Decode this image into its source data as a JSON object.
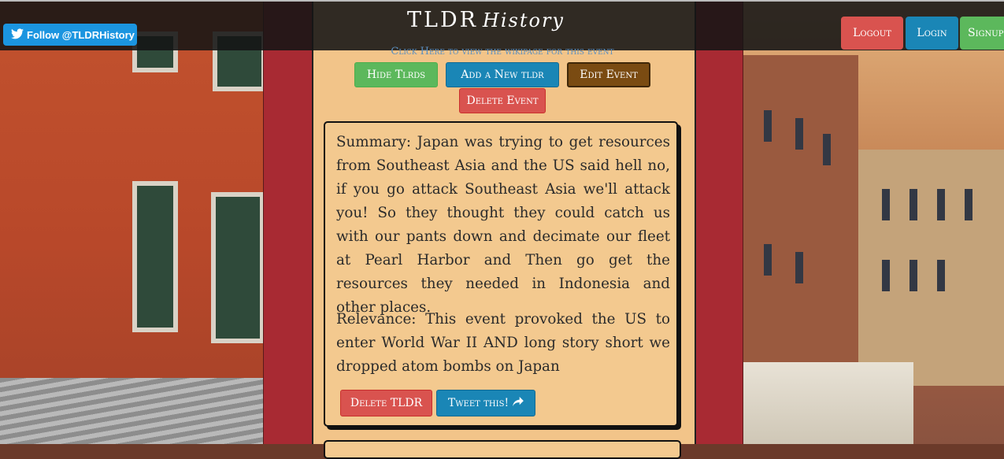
{
  "header": {
    "brand_main": "TLDR",
    "brand_script": "History",
    "follow_label": "Follow @TLDRHistory",
    "auth": {
      "logout": "Logout",
      "login": "Login",
      "signup": "Signup"
    }
  },
  "event": {
    "wiki_link": "Click Here to view the wikipage for this event",
    "actions": {
      "hide_tldrs": "Hide Tlrds",
      "add_tldr": "Add a New tldr",
      "edit_event": "Edit Event",
      "delete_event": "Delete Event"
    }
  },
  "tldr": {
    "summary": "Summary: Japan was trying to get resources from Southeast Asia and the US said hell no, if you go attack Southeast Asia we'll attack you! So they thought they could catch us with our pants down and decimate our fleet at Pearl Harbor and Then go get the resources they needed in Indonesia and other places.",
    "relevance": "Relevance: This event provoked the US to enter World War II AND long story short we dropped atom bombs on Japan",
    "delete_label": "Delete TLDR",
    "tweet_label": "Tweet this!"
  },
  "colors": {
    "frame_red": "#a82a33",
    "parchment": "#f2c489",
    "twitter_blue": "#1b95e0"
  }
}
